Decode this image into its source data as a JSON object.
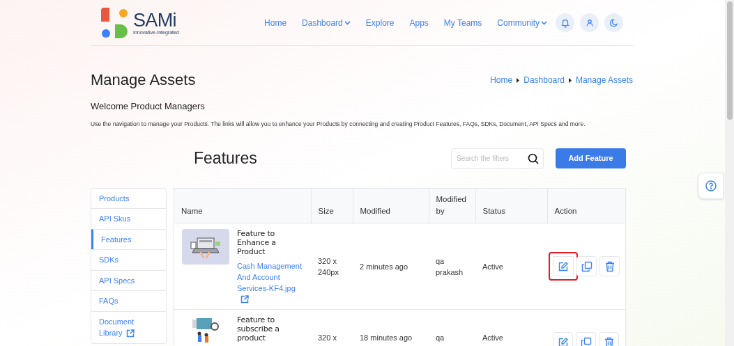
{
  "header": {
    "logo_name": "SAMi",
    "logo_tagline": "Innovative-Integrated",
    "nav": [
      {
        "label": "Home",
        "dropdown": false
      },
      {
        "label": "Dashboard",
        "dropdown": true
      },
      {
        "label": "Explore",
        "dropdown": false
      },
      {
        "label": "Apps",
        "dropdown": false
      },
      {
        "label": "My Teams",
        "dropdown": false
      },
      {
        "label": "Community",
        "dropdown": true
      }
    ],
    "icon_buttons": [
      {
        "kind": "bell"
      },
      {
        "kind": "user"
      },
      {
        "kind": "moon"
      }
    ]
  },
  "page": {
    "title": "Manage Assets",
    "breadcrumb": [
      "Home",
      "Dashboard",
      "Manage Assets"
    ],
    "welcome": "Welcome Product Managers",
    "description": "Use the navigation to manage your Products. The links will allow you to enhance your Products by connecting and creating Product Features, FAQs, SDKs, Document, API Specs and more."
  },
  "section": {
    "title": "Features",
    "search": {
      "placeholder": "Search the filters"
    },
    "add_button": "Add Feature"
  },
  "sidebar": {
    "items": [
      {
        "label": "Products",
        "selected": false,
        "external": false
      },
      {
        "label": "API Skus",
        "selected": false,
        "external": false
      },
      {
        "label": "Features",
        "selected": true,
        "external": false
      },
      {
        "label": "SDKs",
        "selected": false,
        "external": false
      },
      {
        "label": "API Specs",
        "selected": false,
        "external": false
      },
      {
        "label": "FAQs",
        "selected": false,
        "external": false
      },
      {
        "label": "Document Library",
        "selected": false,
        "external": true
      }
    ]
  },
  "table": {
    "columns": [
      "Name",
      "Size",
      "Modified",
      "Modified by",
      "Status",
      "Action"
    ],
    "rows": [
      {
        "thumbnail": {
          "kind": "laptop"
        },
        "title": "Feature to Enhance a Product",
        "file": "Cash Management And Account Services-KF4.jpg",
        "size": "320 x 240px",
        "modified": "2 minutes ago",
        "modified_by": "qa prakash",
        "status": "Active",
        "actions": [
          {
            "kind": "edit",
            "highlighted": true
          },
          {
            "kind": "copy",
            "highlighted": false
          },
          {
            "kind": "delete",
            "highlighted": false
          }
        ]
      },
      {
        "thumbnail": {
          "kind": "people"
        },
        "title": "Feature to subscribe a product",
        "size": "320 x",
        "modified": "18 minutes ago",
        "modified_by": "qa",
        "status": "Active",
        "actions": [
          {
            "kind": "edit",
            "highlighted": false
          },
          {
            "kind": "copy",
            "highlighted": false
          },
          {
            "kind": "delete",
            "highlighted": false
          }
        ]
      }
    ]
  }
}
